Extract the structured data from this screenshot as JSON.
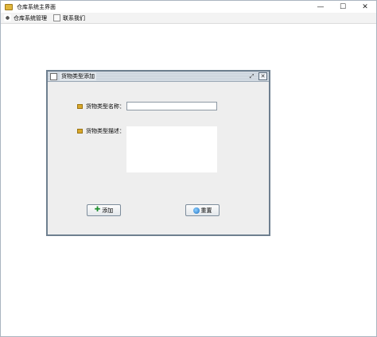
{
  "window": {
    "title": "仓库系统主界面",
    "controls": {
      "minimize": "—",
      "maximize": "☐",
      "close": "✕"
    }
  },
  "menubar": {
    "items": [
      {
        "label": "仓库系统管理",
        "icon": "tools-icon"
      },
      {
        "label": "联系我们",
        "icon": "document-icon"
      }
    ]
  },
  "internal_frame": {
    "title": "货物类型添加",
    "controls": {
      "restore": "⤢",
      "close": "✕"
    },
    "form": {
      "name_label": "货物类型名称：",
      "name_value": "",
      "description_label": "货物类型描述：",
      "description_value": "",
      "add_button": "添加",
      "reset_button": "重置"
    }
  }
}
